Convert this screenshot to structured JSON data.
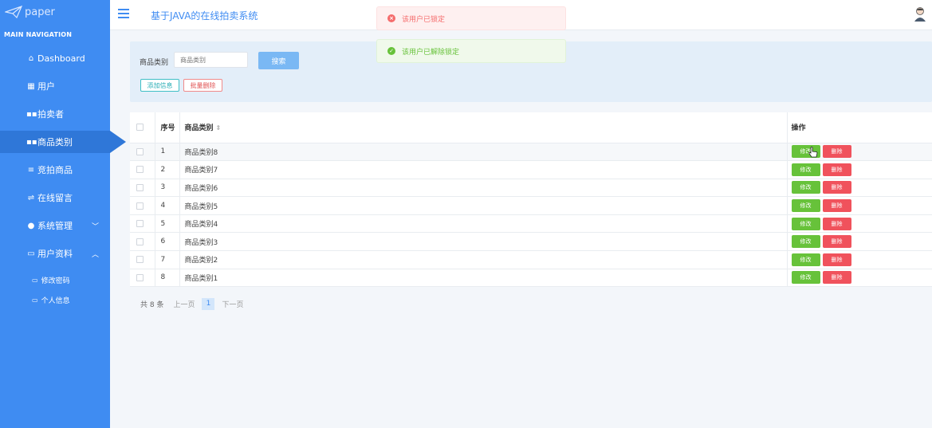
{
  "sidebar": {
    "logo_text": "paper",
    "heading": "MAIN NAVIGATION",
    "items": [
      {
        "label": "Dashboard",
        "icon": "home-icon"
      },
      {
        "label": "用户",
        "icon": "grid-icon"
      },
      {
        "label": "拍卖者",
        "icon": "grid-icon"
      },
      {
        "label": "商品类别",
        "icon": "grid-icon",
        "active": true
      },
      {
        "label": "竞拍商品",
        "icon": "list-icon"
      },
      {
        "label": "在线留言",
        "icon": "sliders-icon"
      },
      {
        "label": "系统管理",
        "icon": "user-icon",
        "chevron": "down"
      },
      {
        "label": "用户资料",
        "icon": "card-icon",
        "chevron": "up"
      }
    ],
    "sub_items": [
      {
        "label": "修改密码",
        "icon": "folder-icon"
      },
      {
        "label": "个人信息",
        "icon": "folder-icon"
      }
    ]
  },
  "header": {
    "title": "基于JAVA的在线拍卖系统"
  },
  "toasts": {
    "error": "该用户已锁定",
    "success": "该用户已解除锁定"
  },
  "search": {
    "label": "商品类别",
    "placeholder": "商品类别",
    "search_button": "搜索",
    "add_button": "添加信息",
    "batch_delete_button": "批量删除"
  },
  "table": {
    "headers": {
      "no": "序号",
      "category": "商品类别",
      "operation": "操作"
    },
    "edit_label": "修改",
    "delete_label": "删除",
    "rows": [
      {
        "no": "1",
        "category": "商品类别8"
      },
      {
        "no": "2",
        "category": "商品类别7"
      },
      {
        "no": "3",
        "category": "商品类别6"
      },
      {
        "no": "4",
        "category": "商品类别5"
      },
      {
        "no": "5",
        "category": "商品类别4"
      },
      {
        "no": "6",
        "category": "商品类别3"
      },
      {
        "no": "7",
        "category": "商品类别2"
      },
      {
        "no": "8",
        "category": "商品类别1"
      }
    ]
  },
  "pagination": {
    "total": "共 8 条",
    "prev": "上一页",
    "current": "1",
    "next": "下一页"
  },
  "colors": {
    "sidebar": "#3f8cf2",
    "active_item": "#2f77d8",
    "edit": "#67c23a",
    "delete": "#f0525c",
    "accent": "#3f8cf2"
  }
}
